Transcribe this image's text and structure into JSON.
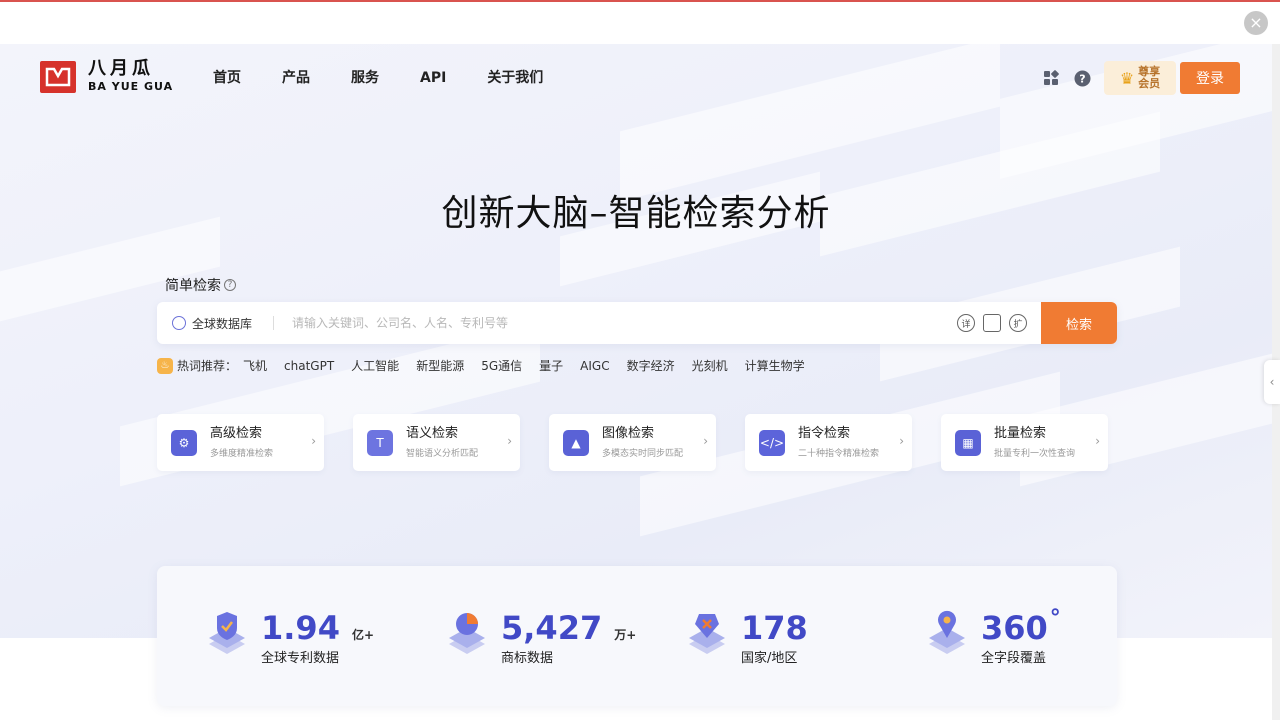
{
  "header": {
    "logo_cn": "八月瓜",
    "logo_en": "BA YUE GUA",
    "nav": [
      "首页",
      "产品",
      "服务",
      "API",
      "关于我们"
    ],
    "vip_label_1": "尊享",
    "vip_label_2": "会员",
    "login_label": "登录"
  },
  "hero": {
    "title": "创新大脑–智能检索分析"
  },
  "search": {
    "section_label": "简单检索",
    "database_label": "全球数据库",
    "placeholder": "请输入关键词、公司名、人名、专利号等",
    "tool_1": "详",
    "tool_2": "",
    "tool_3": "扩",
    "button_label": "检索"
  },
  "hot": {
    "label": "热词推荐：",
    "items": [
      "飞机",
      "chatGPT",
      "人工智能",
      "新型能源",
      "5G通信",
      "量子",
      "AIGC",
      "数字经济",
      "光刻机",
      "计算生物学"
    ]
  },
  "modes": [
    {
      "title": "高级检索",
      "sub": "多维度精准检索",
      "icon": "gear-search-icon",
      "color": "#5b63d8"
    },
    {
      "title": "语义检索",
      "sub": "智能语义分析匹配",
      "icon": "text-icon",
      "color": "#6d74e0"
    },
    {
      "title": "图像检索",
      "sub": "多模态实时同步匹配",
      "icon": "image-icon",
      "color": "#5a62d6"
    },
    {
      "title": "指令检索",
      "sub": "二十种指令精准检索",
      "icon": "code-icon",
      "color": "#5c64da"
    },
    {
      "title": "批量检索",
      "sub": "批量专利一次性查询",
      "icon": "grid-search-icon",
      "color": "#5a62d6"
    }
  ],
  "stats": [
    {
      "value": "1.94",
      "unit": "亿+",
      "label": "全球专利数据"
    },
    {
      "value": "5,427",
      "unit": "万+",
      "label": "商标数据"
    },
    {
      "value": "178",
      "unit": "",
      "label": "国家/地区"
    },
    {
      "value": "360",
      "unit": "°",
      "label": "全字段覆盖"
    }
  ],
  "colors": {
    "accent": "#f07b33",
    "brand": "#d6322b",
    "primary": "#4149c6"
  }
}
